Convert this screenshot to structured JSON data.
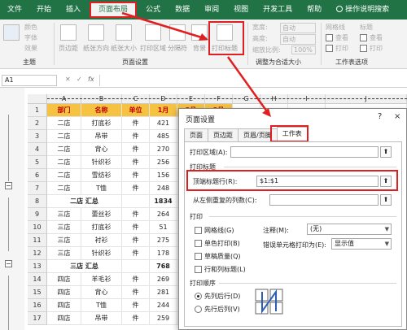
{
  "tabs": [
    "文件",
    "开始",
    "插入",
    "页面布局",
    "公式",
    "数据",
    "审阅",
    "视图",
    "开发工具",
    "帮助",
    "操作说明搜索"
  ],
  "ribbon": {
    "theme_group": "主题",
    "theme_buttons": [
      "颜色",
      "字体",
      "效果"
    ],
    "page_setup_buttons": [
      "页边距",
      "纸张方向",
      "纸张大小",
      "打印区域",
      "分隔符",
      "背景",
      "打印标题"
    ],
    "page_setup_group": "页面设置",
    "scale_rows": [
      {
        "label": "宽度:",
        "value": "自动"
      },
      {
        "label": "高度:",
        "value": "自动"
      },
      {
        "label": "缩放比例:",
        "value": "100%"
      }
    ],
    "scale_group": "调整为合适大小",
    "sheet_opts": {
      "gridlines": "网格线",
      "headings": "标题",
      "view": "查看",
      "print": "打印"
    },
    "sheet_group": "工作表选项"
  },
  "formula_bar": {
    "name_box": "A1",
    "fx": "fx"
  },
  "sheet": {
    "columns": [
      "A",
      "B",
      "C",
      "D",
      "E",
      "F",
      "G",
      "H",
      "I",
      "J"
    ],
    "header": [
      "部门",
      "名称",
      "单位",
      "1月",
      "2月",
      "3月"
    ],
    "rows": [
      {
        "num": "1",
        "cells": [
          "部门",
          "名称",
          "单位",
          "1月",
          "2月",
          "3月"
        ]
      },
      {
        "num": "2",
        "cells": [
          "二店",
          "打底衫",
          "件",
          "421",
          "",
          ""
        ]
      },
      {
        "num": "3",
        "cells": [
          "二店",
          "吊带",
          "件",
          "485",
          "",
          ""
        ]
      },
      {
        "num": "4",
        "cells": [
          "二店",
          "背心",
          "件",
          "270",
          "",
          ""
        ]
      },
      {
        "num": "5",
        "cells": [
          "二店",
          "针织衫",
          "件",
          "256",
          "",
          ""
        ]
      },
      {
        "num": "6",
        "cells": [
          "二店",
          "雪纺衫",
          "件",
          "156",
          "",
          ""
        ]
      },
      {
        "num": "7",
        "cells": [
          "二店",
          "T恤",
          "件",
          "248",
          "",
          ""
        ]
      },
      {
        "num": "8",
        "cells": [
          "二店 汇总",
          "",
          "",
          "1834",
          "",
          ""
        ]
      },
      {
        "num": "9",
        "cells": [
          "三店",
          "蕾丝衫",
          "件",
          "264",
          "",
          ""
        ]
      },
      {
        "num": "10",
        "cells": [
          "三店",
          "打底衫",
          "件",
          "51",
          "",
          ""
        ]
      },
      {
        "num": "11",
        "cells": [
          "三店",
          "衬衫",
          "件",
          "275",
          "",
          ""
        ]
      },
      {
        "num": "12",
        "cells": [
          "三店",
          "针织衫",
          "件",
          "178",
          "",
          ""
        ]
      },
      {
        "num": "13",
        "cells": [
          "三店 汇总",
          "",
          "",
          "768",
          "",
          ""
        ]
      },
      {
        "num": "14",
        "cells": [
          "四店",
          "羊毛衫",
          "件",
          "269",
          "",
          ""
        ]
      },
      {
        "num": "15",
        "cells": [
          "四店",
          "背心",
          "件",
          "281",
          "",
          ""
        ]
      },
      {
        "num": "16",
        "cells": [
          "四店",
          "T恤",
          "件",
          "244",
          "",
          ""
        ]
      },
      {
        "num": "17",
        "cells": [
          "四店",
          "吊带",
          "件",
          "259",
          "",
          ""
        ]
      }
    ]
  },
  "dialog": {
    "title": "页面设置",
    "help": "?",
    "close": "×",
    "tabs": [
      "页面",
      "页边距",
      "页眉/页脚",
      "工作表"
    ],
    "print_area_label": "打印区域(A):",
    "print_titles_label": "打印标题",
    "top_rows_label": "顶端标题行(R):",
    "top_rows_value": "$1:$1",
    "left_cols_label": "从左侧重复的列数(C):",
    "print_label": "打印",
    "checks": [
      "网格线(G)",
      "单色打印(B)",
      "草稿质量(Q)",
      "行和列标题(L)"
    ],
    "comments_label": "注释(M):",
    "comments_value": "(无)",
    "errors_label": "错误单元格打印为(E):",
    "errors_value": "显示值",
    "order_label": "打印顺序",
    "order_options": [
      "先列后行(D)",
      "先行后列(V)"
    ]
  },
  "colors": {
    "excel_green": "#217346",
    "highlight": "#e02020",
    "header_fill": "#f5c242",
    "header_text": "#c00000"
  }
}
